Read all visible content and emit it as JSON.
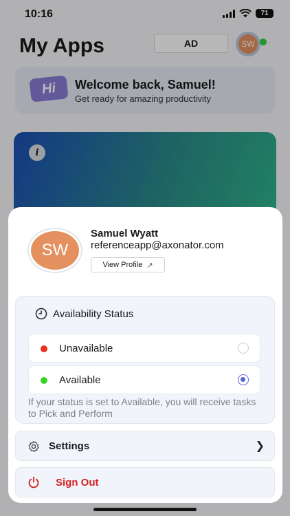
{
  "status_bar": {
    "time": "10:16",
    "battery": "71"
  },
  "header": {
    "title": "My Apps",
    "ad_label": "AD",
    "avatar_initials": "SW"
  },
  "welcome": {
    "badge": "Hi",
    "title": "Welcome back, Samuel!",
    "subtitle": "Get ready for amazing productivity"
  },
  "hero": {
    "info_glyph": "i"
  },
  "profile": {
    "initials": "SW",
    "name": "Samuel Wyatt",
    "email": "referenceapp@axonator.com",
    "view_profile_label": "View Profile"
  },
  "availability": {
    "title": "Availability Status",
    "options": [
      {
        "label": "Unavailable",
        "color": "#e8321f",
        "selected": false
      },
      {
        "label": "Available",
        "color": "#3ad32a",
        "selected": true
      }
    ],
    "note": "If your status is set to Available, you will receive tasks to Pick and Perform"
  },
  "menu": {
    "settings_label": "Settings",
    "signout_label": "Sign Out"
  },
  "colors": {
    "accent": "#5a63d6",
    "danger": "#d61f1f",
    "avatar": "#e4915f"
  }
}
